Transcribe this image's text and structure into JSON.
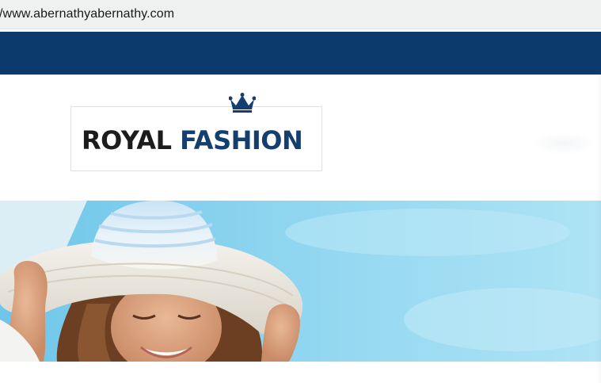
{
  "browser": {
    "url": "/www.abernathyabernathy.com"
  },
  "logo": {
    "word_1": "ROYAL",
    "word_2": "FASHION",
    "icon": "crown-icon"
  },
  "hero": {
    "image": "woman-in-white-sun-hat-photo"
  },
  "colors": {
    "nav": "#0c3a6c",
    "logo_accent": "#133e6e",
    "sky": "#9ddcf2"
  }
}
